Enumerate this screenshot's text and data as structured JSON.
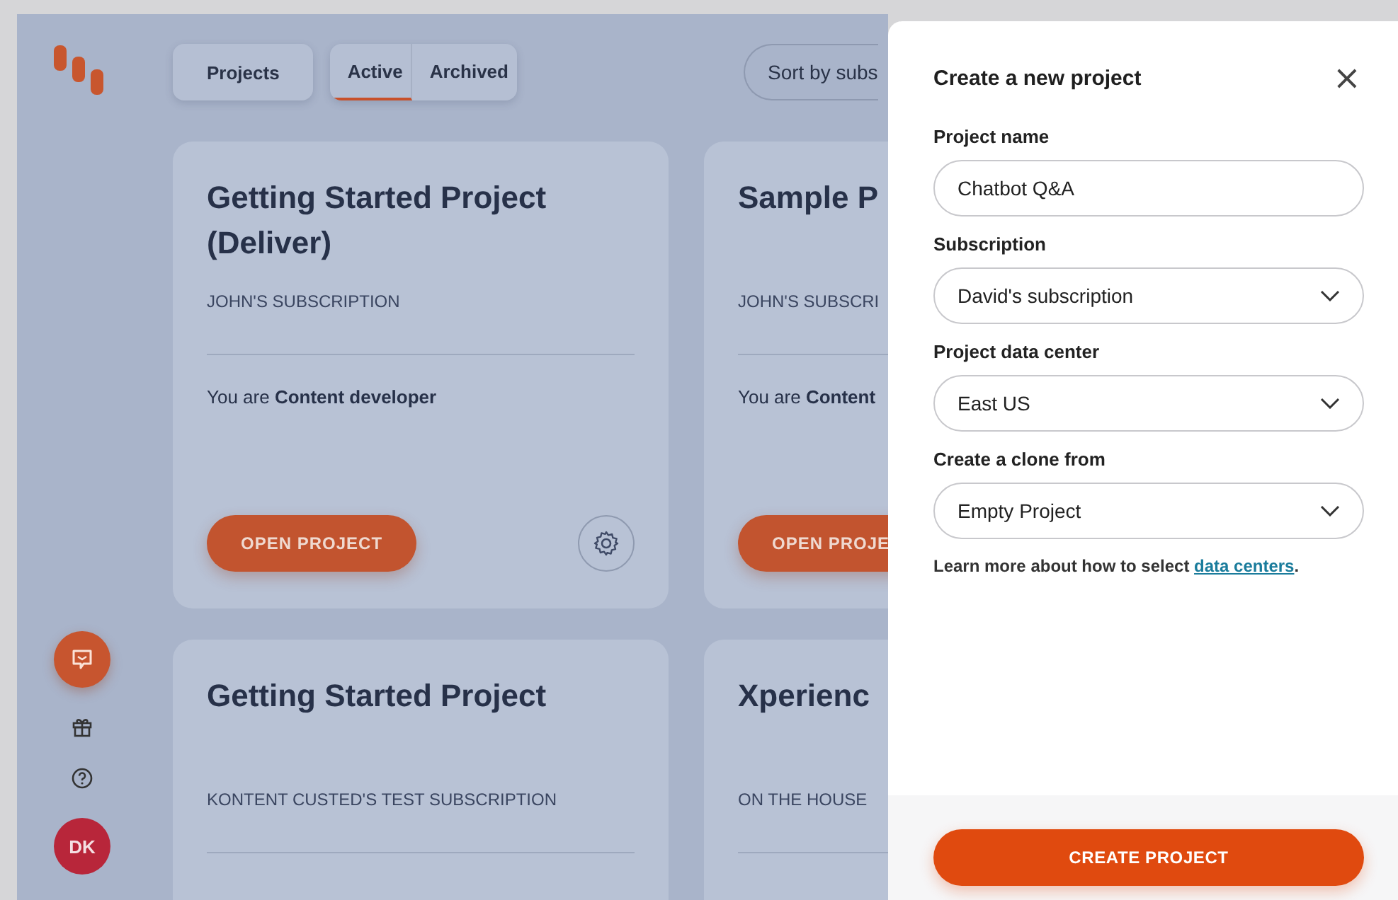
{
  "sidebar": {
    "items": [
      {
        "kind": "chat"
      },
      {
        "kind": "gift"
      },
      {
        "kind": "help"
      },
      {
        "kind": "avatar",
        "initials": "DK"
      }
    ]
  },
  "toolbar": {
    "projects_button": "Projects",
    "tabs": [
      {
        "label": "Active",
        "selected": true
      },
      {
        "label": "Archived",
        "selected": false
      }
    ],
    "sort": "Sort by subs"
  },
  "cards": [
    {
      "title": "Getting Started Project (Deliver)",
      "subscription": "JOHN'S SUBSCRIPTION",
      "role": "You are **Content developer**",
      "button": "OPEN PROJECT",
      "settings": true
    },
    {
      "title": "Sample P",
      "subscription": "JOHN'S SUBSCRI",
      "role": "You are **Content**",
      "button": "OPEN PROJE"
    },
    {
      "title": "Getting Started Project",
      "subscription": "KONTENT CUSTED'S TEST SUBSCRIPTION"
    },
    {
      "title": "Xperienc",
      "subscription": "ON THE HOUSE"
    }
  ],
  "panel": {
    "title": "Create a new project",
    "close": "×",
    "fields": [
      {
        "label": "Project name",
        "value": "Chatbot Q&A",
        "kind": "text"
      },
      {
        "label": "Subscription",
        "value": "David's subscription",
        "kind": "select"
      },
      {
        "label": "Project data center",
        "value": "East US",
        "kind": "select"
      },
      {
        "label": "Create a clone from",
        "value": "Empty Project",
        "kind": "select"
      }
    ],
    "help_text": "Learn more about how to select ",
    "help_link": "data centers",
    "help_end": ".",
    "submit": "CREATE PROJECT"
  }
}
